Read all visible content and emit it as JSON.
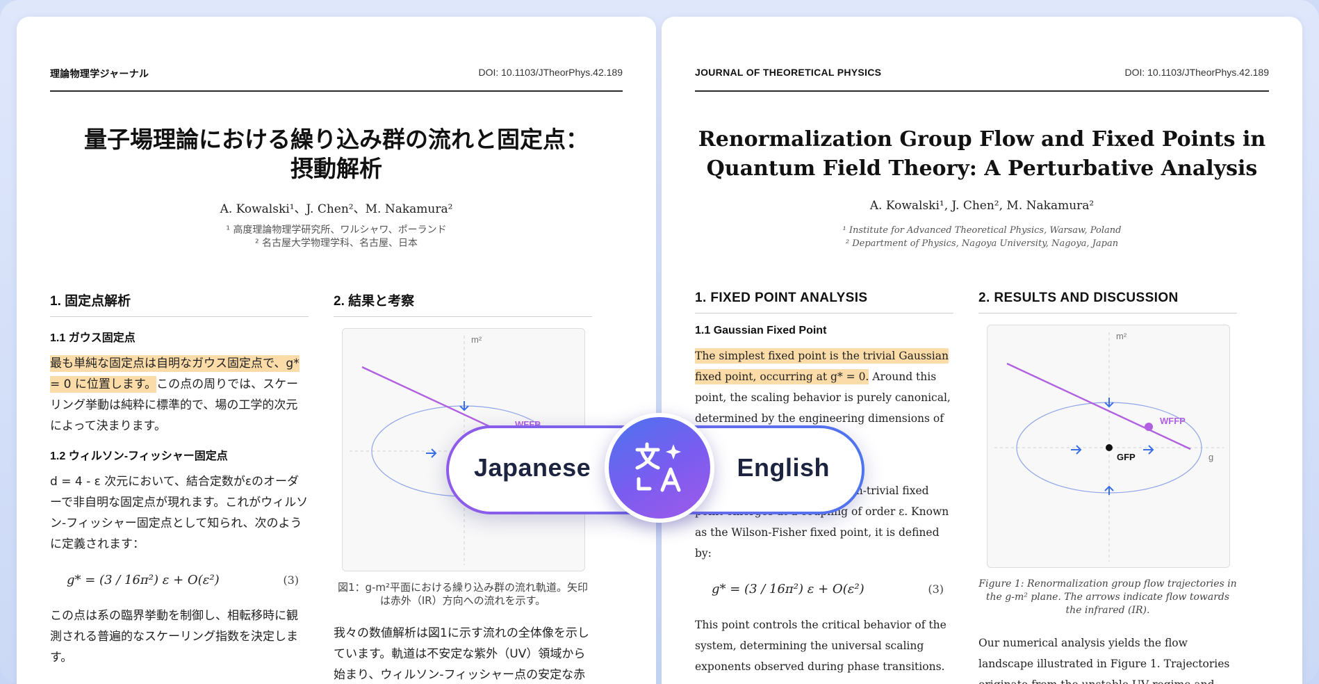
{
  "left": {
    "journal": "理論物理学ジャーナル",
    "doi": "DOI: 10.1103/JTheorPhys.42.189",
    "title_line1": "量子場理論における繰り込み群の流れと固定点：",
    "title_line2": "摂動解析",
    "authors": "A. Kowalski¹、J. Chen²、M. Nakamura²",
    "affil1": "¹ 高度理論物理学研究所、ワルシャワ、ポーランド",
    "affil2": "² 名古屋大学物理学科、名古屋、日本",
    "sec1_heading": "1. 固定点解析",
    "sub11": "1.1 ガウス固定点",
    "p1_highlight": "最も単純な固定点は自明なガウス固定点で、g* = 0 に位置します。",
    "p1_rest": "この点の周りでは、スケーリング挙動は純粋に標準的で、場の工学的次元によって決まります。",
    "sub12": "1.2 ウィルソン-フィッシャー固定点",
    "p2": "d = 4 - ε 次元において、結合定数がεのオーダーで非自明な固定点が現れます。これがウィルソン-フィッシャー固定点として知られ、次のように定義されます：",
    "equation": "g* = (3 / 16π²) ε + O(ε²)",
    "eq_number": "(3)",
    "p3": "この点は系の臨界挙動を制御し、相転移時に観測される普遍的なスケーリング指数を決定します。",
    "sec2_heading": "2. 結果と考察",
    "caption": "図1：g-m²平面における繰り込み群の流れ軌道。矢印は赤外（IR）方向への流れを示す。",
    "p4": "我々の数値解析は図1に示す流れの全体像を示しています。軌道は不安定な紫外（UV）領域から始まり、ウィルソン-フィッシャー点の安定な赤外アトラクターに収束しま"
  },
  "right": {
    "journal": "JOURNAL OF THEORETICAL PHYSICS",
    "doi": "DOI: 10.1103/JTheorPhys.42.189",
    "title_line1": "Renormalization Group Flow and Fixed Points in",
    "title_line2": "Quantum Field Theory: A Perturbative Analysis",
    "authors": "A. Kowalski¹, J. Chen², M. Nakamura²",
    "affil1": "¹ Institute for Advanced Theoretical Physics, Warsaw, Poland",
    "affil2": "² Department of Physics, Nagoya University, Nagoya, Japan",
    "sec1_heading": "1. FIXED POINT ANALYSIS",
    "sub11": "1.1 Gaussian Fixed Point",
    "p1_highlight": "The simplest fixed point is the trivial Gaussian fixed point, occurring at g* = 0.",
    "p1_rest": " Around this point, the scaling behavior is purely canonical, determined by the engineering dimensions of the",
    "sub12": "1.2 Wilson-Fisher Fixed Point",
    "p2": "In d = 4 − ε dimensions, a non-trivial fixed point emerges at a coupling of order ε. Known as the Wilson-Fisher fixed point, it is defined by:",
    "equation": "g* = (3 / 16π²) ε + O(ε²)",
    "eq_number": "(3)",
    "p3": "This point controls the critical behavior of the system, determining the universal scaling exponents observed during phase transitions.",
    "sec2_heading": "2. RESULTS AND DISCUSSION",
    "caption": "Figure 1: Renormalization group flow trajectories in the g-m² plane. The arrows indicate flow towards the infrared (IR).",
    "p4": "Our numerical analysis yields the flow landscape illustrated in Figure 1. Trajectories originate from the unstable UV regime and converge onto the"
  },
  "figure": {
    "y_axis_label": "m²",
    "x_axis_label": "g",
    "wffp_label": "WFFP",
    "gfp_label": "GFP",
    "flow_color": "#b060e0",
    "arrow_color": "#3a6ee8"
  },
  "toggle": {
    "source_lang": "Japanese",
    "target_lang": "English",
    "icon": "translate-icon"
  }
}
